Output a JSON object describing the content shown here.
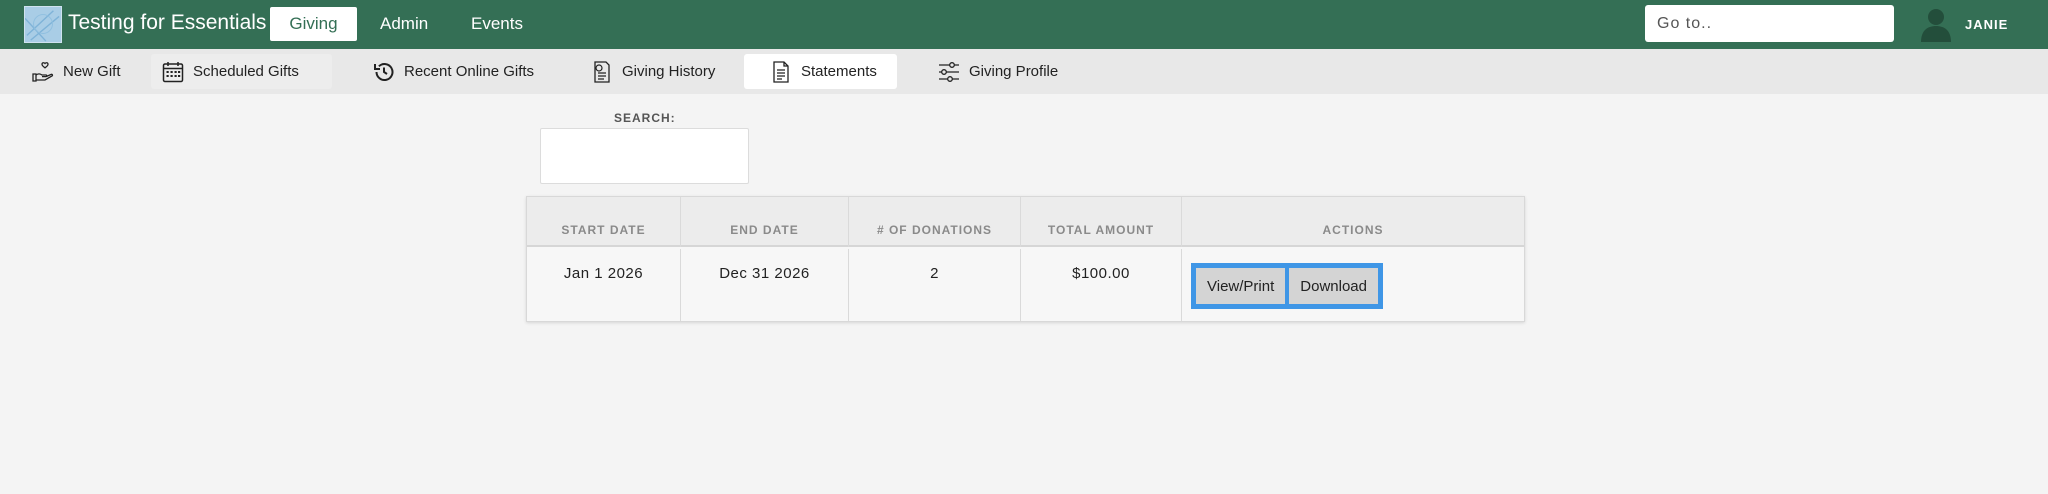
{
  "app": {
    "title": "Testing for Essentials"
  },
  "nav": {
    "tabs": [
      {
        "label": "Giving",
        "active": true
      },
      {
        "label": "Admin",
        "active": false
      },
      {
        "label": "Events",
        "active": false
      }
    ]
  },
  "goto": {
    "placeholder": "Go to.."
  },
  "user": {
    "name": "JANIE"
  },
  "subnav": {
    "items": [
      {
        "label": "New Gift",
        "icon": "hand-heart-icon"
      },
      {
        "label": "Scheduled Gifts",
        "icon": "calendar-icon"
      },
      {
        "label": "Recent Online Gifts",
        "icon": "history-icon"
      },
      {
        "label": "Giving History",
        "icon": "receipt-icon"
      },
      {
        "label": "Statements",
        "icon": "document-icon",
        "active": true
      },
      {
        "label": "Giving Profile",
        "icon": "sliders-icon"
      }
    ]
  },
  "search": {
    "label": "SEARCH:",
    "value": ""
  },
  "table": {
    "columns": [
      "START DATE",
      "END DATE",
      "# OF DONATIONS",
      "TOTAL AMOUNT",
      "ACTIONS"
    ],
    "rows": [
      {
        "start": "Jan 1 2026",
        "end": "Dec 31 2026",
        "donations": "2",
        "total": "$100.00"
      }
    ],
    "actions": {
      "view": "View/Print",
      "download": "Download"
    }
  },
  "colors": {
    "header": "#346f55",
    "accent": "#3f96e6",
    "background": "#f4f4f4"
  }
}
